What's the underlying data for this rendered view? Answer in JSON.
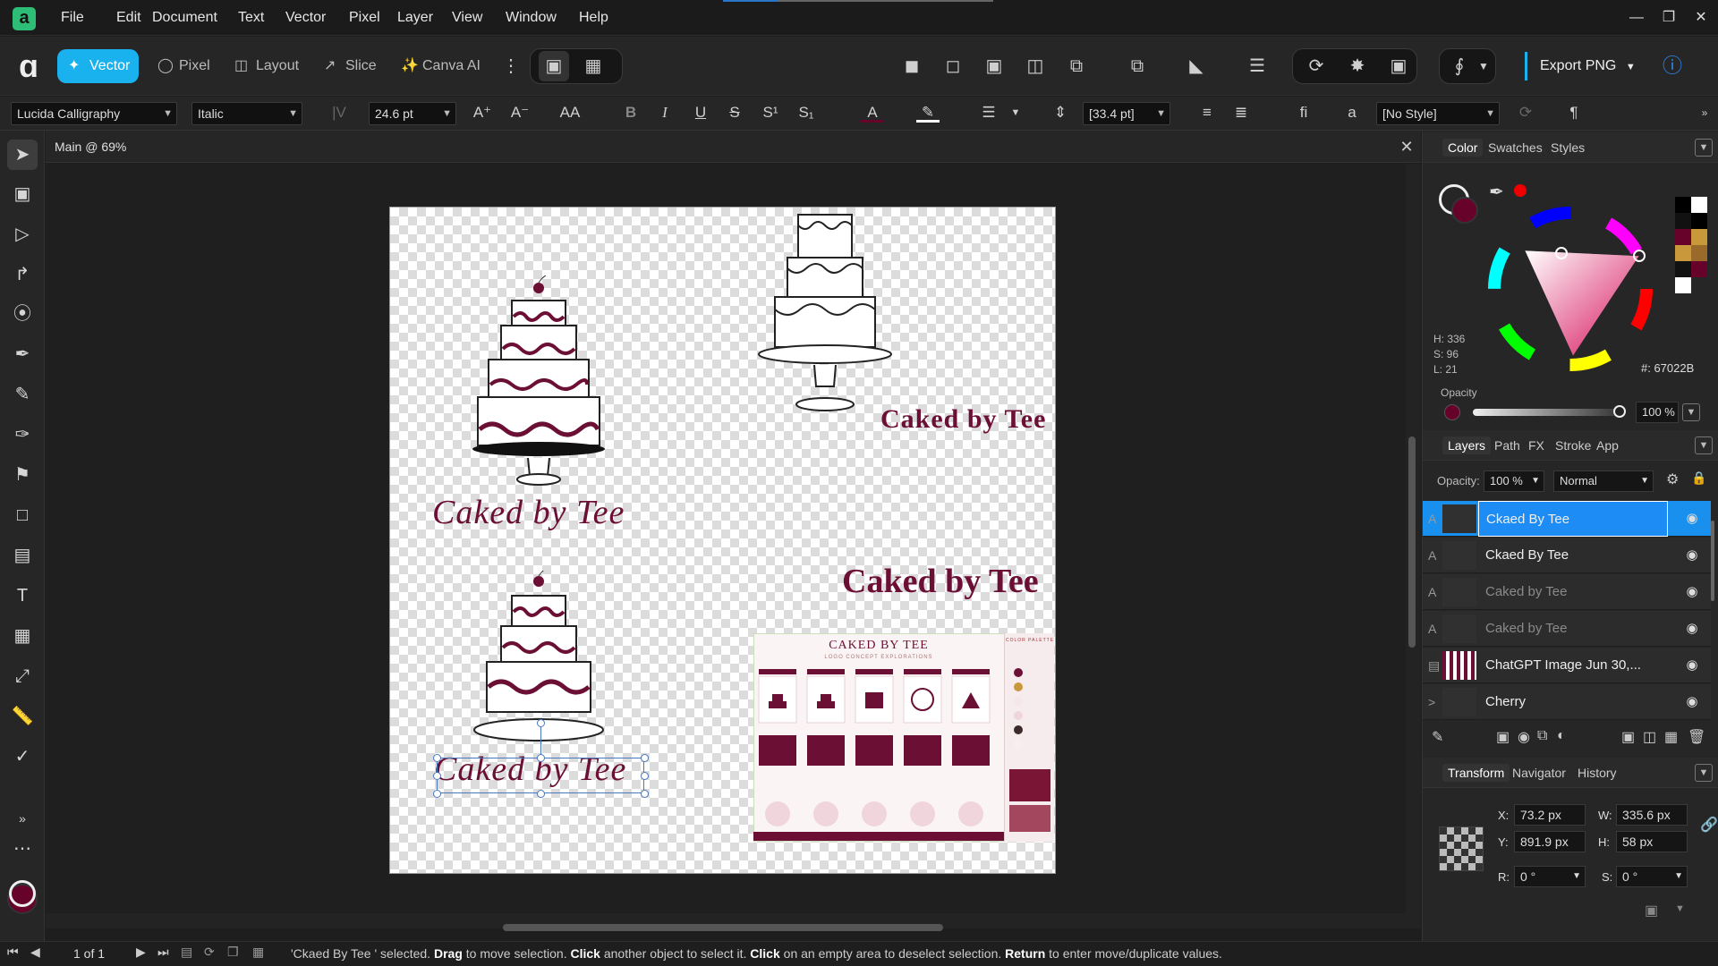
{
  "app": {
    "icon_letter": "a"
  },
  "menubar": {
    "items": [
      "File",
      "Edit",
      "Document",
      "Text",
      "Vector",
      "Pixel",
      "Layer",
      "View",
      "Window",
      "Help"
    ]
  },
  "personas": {
    "vector": "Vector",
    "pixel": "Pixel",
    "layout": "Layout",
    "slice": "Slice",
    "canva": "Canva AI"
  },
  "toolbar": {
    "export_label": "Export PNG"
  },
  "context": {
    "font_family": "Lucida Calligraphy",
    "font_style": "Italic",
    "font_size": "24.6 pt",
    "leading": "[33.4 pt]",
    "para_style": "[No Style]",
    "btn_aa": "AA",
    "btn_fi": "fi",
    "btn_a": "a"
  },
  "document": {
    "tab_title": "Main @ 69%"
  },
  "canvas": {
    "text1": "Caked by Tee",
    "text2": "Caked by Tee",
    "text3": "Caked by Tee",
    "text4": "Caked by Tee",
    "sheet_title": "CAKED BY TEE",
    "sheet_subtitle": "LOGO CONCEPT EXPLORATIONS",
    "sheet_palette_title": "COLOR PALETTE"
  },
  "color_panel": {
    "tabs": [
      "Color",
      "Swatches",
      "Styles"
    ],
    "h": "H: 336",
    "s": "S: 96",
    "l": "L: 21",
    "hex": "#: 67022B",
    "opacity_label": "Opacity",
    "opacity_value": "100 %",
    "current_color": "#67022b"
  },
  "layers_panel": {
    "tabs": [
      "Layers",
      "Path",
      "FX",
      "Stroke",
      "App"
    ],
    "opacity_label": "Opacity:",
    "opacity_value": "100 %",
    "blend_mode": "Normal",
    "layers": [
      {
        "type": "A",
        "name": "Ckaed By Tee"
      },
      {
        "type": "A",
        "name": "Ckaed By Tee"
      },
      {
        "type": "A",
        "name": "Caked by Tee"
      },
      {
        "type": "A",
        "name": "Caked by Tee"
      },
      {
        "type": "",
        "name": "ChatGPT Image Jun 30,..."
      },
      {
        "type": ">",
        "name": "Cherry"
      }
    ]
  },
  "transform_panel": {
    "tabs": [
      "Transform",
      "Navigator",
      "History"
    ],
    "x_label": "X:",
    "x": "73.2 px",
    "y_label": "Y:",
    "y": "891.9 px",
    "w_label": "W:",
    "w": "335.6 px",
    "h_label": "H:",
    "h": "58 px",
    "r_label": "R:",
    "r": "0 °",
    "s_label": "S:",
    "s": "0 °"
  },
  "status": {
    "page": "1 of 1",
    "msg_a": "'Ckaed By Tee ' selected. ",
    "msg_b": "Drag",
    "msg_c": " to move selection. ",
    "msg_d": "Click",
    "msg_e": " another object to select it. ",
    "msg_f": "Click",
    "msg_g": " on an empty area to deselect selection. ",
    "msg_h": "Return",
    "msg_i": " to enter move/duplicate values."
  }
}
